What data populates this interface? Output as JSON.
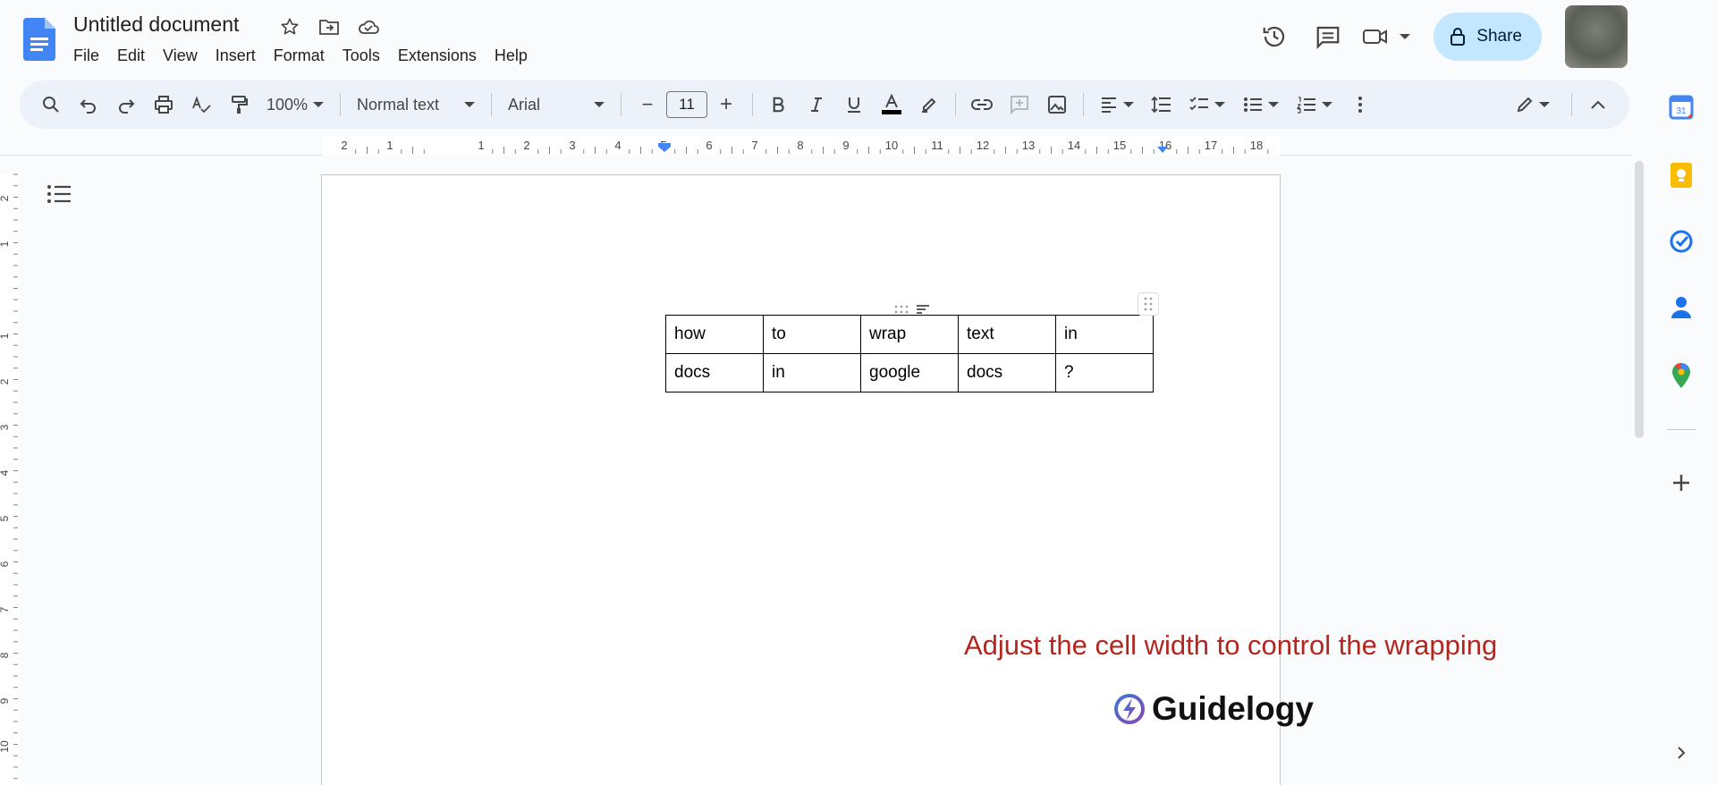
{
  "app": {
    "document_title": "Untitled document"
  },
  "menu": [
    "File",
    "Edit",
    "View",
    "Insert",
    "Format",
    "Tools",
    "Extensions",
    "Help"
  ],
  "header": {
    "share_label": "Share"
  },
  "toolbar": {
    "zoom": "100%",
    "style": "Normal text",
    "font": "Arial",
    "font_size": "11",
    "minus": "−",
    "plus": "+"
  },
  "ruler": {
    "ticks": [
      "2",
      "1",
      "1",
      "2",
      "3",
      "4",
      "5",
      "6",
      "7",
      "8",
      "9",
      "10",
      "11",
      "12",
      "13",
      "14",
      "15",
      "16",
      "17",
      "18"
    ],
    "vticks": [
      "2",
      "1",
      "1",
      "2",
      "3",
      "4",
      "5",
      "6",
      "7",
      "8",
      "9",
      "10"
    ]
  },
  "document": {
    "table": [
      [
        "how",
        "to",
        "wrap",
        "text",
        "in"
      ],
      [
        "docs",
        "in",
        "google",
        "docs",
        "?"
      ]
    ],
    "caption": "Adjust the cell width to control the wrapping",
    "brand": "Guidelogy"
  },
  "colors": {
    "caption": "#b3261e",
    "share_bg": "#c2e7ff",
    "toolbar_bg": "#edf2fa",
    "docs_blue": "#4285f4"
  }
}
